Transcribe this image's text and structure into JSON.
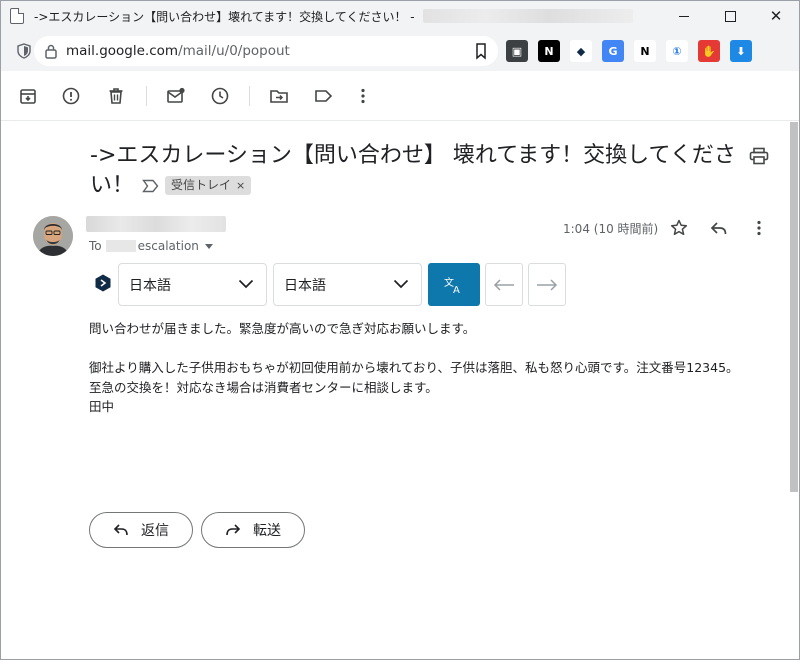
{
  "window": {
    "title": "->エスカレーション【問い合わせ】壊れてます！交換してください！ -",
    "minimize": "",
    "maximize": "",
    "close": "✕"
  },
  "address_bar": {
    "url_host": "mail.google.com",
    "url_path": "/mail/u/0/popout"
  },
  "extensions": [
    {
      "name": "ext-monitor-icon",
      "glyph": "▣",
      "bg": "#3c4043",
      "fg": "#ffffff"
    },
    {
      "name": "ext-notion-icon",
      "glyph": "N",
      "bg": "#000000",
      "fg": "#ffffff"
    },
    {
      "name": "ext-deepl-icon",
      "glyph": "◆",
      "bg": "#ffffff",
      "fg": "#0f2b46"
    },
    {
      "name": "ext-google-translate-icon",
      "glyph": "G",
      "bg": "#4285f4",
      "fg": "#ffffff"
    },
    {
      "name": "ext-notion-clipper-icon",
      "glyph": "N",
      "bg": "#ffffff",
      "fg": "#000000"
    },
    {
      "name": "ext-1password-icon",
      "glyph": "①",
      "bg": "#ffffff",
      "fg": "#1a73e8"
    },
    {
      "name": "ext-adblock-icon",
      "glyph": "✋",
      "bg": "#e53935",
      "fg": "#ffffff"
    },
    {
      "name": "ext-download-icon",
      "glyph": "⬇",
      "bg": "#1e88e5",
      "fg": "#ffffff"
    }
  ],
  "email": {
    "subject": "->エスカレーション【問い合わせ】 壊れてます！交換してください！",
    "label": "受信トレイ",
    "label_close": "×",
    "to_prefix": "To",
    "to_name": "escalation",
    "timestamp": "1:04 (10 時間前)",
    "body": [
      "問い合わせが届きました。緊急度が高いので急ぎ対応お願いします。",
      "",
      "御社より購入した子供用おもちゃが初回使用前から壊れており、子供は落胆、私も怒り心頭です。注文番号12345。",
      "至急の交換を！対応なき場合は消費者センターに相談します。",
      "田中"
    ]
  },
  "translate": {
    "source_lang": "日本語",
    "target_lang": "日本語",
    "button_glyph": "文A",
    "back": "←",
    "forward": "→"
  },
  "actions": {
    "reply": "返信",
    "forward": "転送"
  },
  "colors": {
    "translate_button": "#0e77ab",
    "chrome_bg": "#f1f3f4"
  }
}
